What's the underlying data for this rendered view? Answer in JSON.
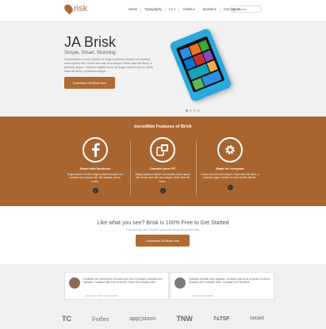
{
  "header": {
    "logo_text": "risk",
    "nav": [
      "Home",
      "Typography",
      "K2 ▾",
      "Colors ▾",
      "Joomla! ▾",
      "Contact Us"
    ],
    "search_placeholder": "Search..."
  },
  "hero": {
    "title": "JA Brisk",
    "subtitle": "Simple. Smart. Stunning",
    "text": "Suspendisse in lorem dictum et magna pharetra aliquet non sodales lorem ipsum bell. Donec sed odio eros aliquet. Nulla vitae elit libero, a pharetra augue. Vivamus sagittis lacus vel augue laoreet rutrum. Nulla vitae elit libero, a pharetra augue.",
    "button": "Download JA Brisk Now",
    "slides": 4,
    "active_slide": 1
  },
  "features": {
    "title": "Incredible Features of Brisk",
    "items": [
      {
        "icon": "facebook-icon",
        "title": "Share with facebook",
        "text": "Suspendisse in lorem magna pharetra aliquet non sodales lorem ipsum bell. Mer facilisis, nisi ac mollis.",
        "more": "›"
      },
      {
        "icon": "connect-pc-icon",
        "title": "Connect your PC",
        "text": "Magna pharetra aliquet non sodales lorem ipsum bell. Donec sed odio eros aliquet. Nulla vitae elit libero.",
        "more": "›"
      },
      {
        "icon": "gear-icon",
        "title": "Made for everyone",
        "text": "Donec sed odio eros aliquet. Nulla vitae elit libero, a pharetra augue. Nullam id dolor id nibh ultricies.",
        "more": "›"
      }
    ]
  },
  "cta": {
    "title": "Like what you see? Brisk is 100% Free to Get Started",
    "subtitle": "Find out why over 200,000 users love us and trust their files.",
    "button": "Download JA Brisk now"
  },
  "testimonials": [
    {
      "text": "Curabitur orci hendrerit in rhoncus at et elit ut Quisque convallis sem egestas. Curabitur quis eros id ornare Fusce Ut convallis dolor.",
      "author": "— Gretchen Sharma, Kessel Pty"
    },
    {
      "text": "Quisque convallis sem egestas. Curabitur quis eros id ornare Ut elit ut Quisque sem convallis dolor. Curabitur orci hendrerit.",
      "author": "— Joe Kowalski, Ghilat"
    }
  ],
  "brands": [
    "TC",
    "Forbes",
    "app▯storm",
    "TNW",
    "7x7SF",
    "betakit"
  ],
  "colors": {
    "accent": "#b06a32",
    "band": "#a8652f"
  }
}
